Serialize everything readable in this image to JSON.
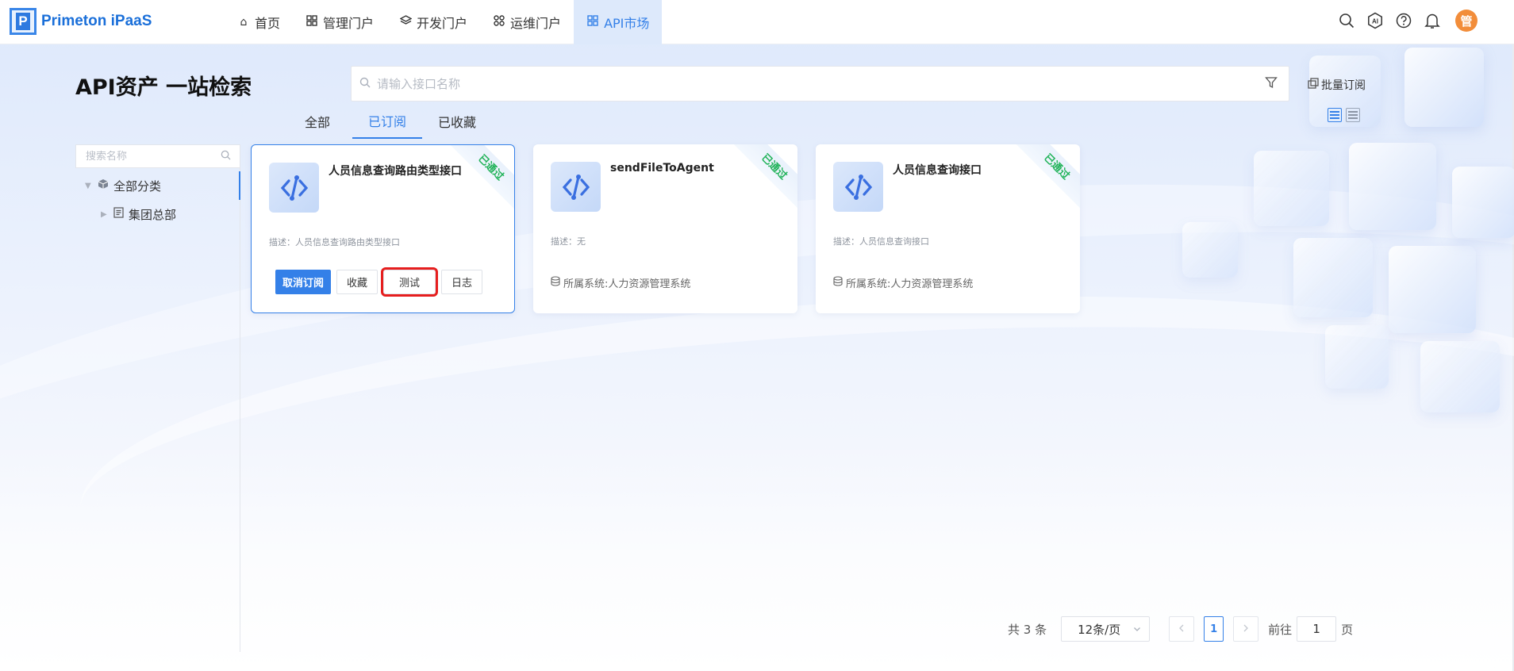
{
  "app": {
    "logo_letter": "P",
    "name": "Primeton iPaaS"
  },
  "nav": [
    {
      "label": "首页",
      "icon": "home-icon"
    },
    {
      "label": "管理门户",
      "icon": "grid-icon"
    },
    {
      "label": "开发门户",
      "icon": "layers-icon"
    },
    {
      "label": "运维门户",
      "icon": "apps-icon"
    },
    {
      "label": "API市场",
      "icon": "grid-icon",
      "active": true
    }
  ],
  "header_tools": {
    "avatar": "管",
    "ai_label": "AI"
  },
  "page": {
    "title": "API资产 一站检索"
  },
  "search": {
    "placeholder": "请输入接口名称",
    "batch_label": "批量订阅"
  },
  "tabs": [
    {
      "label": "全部"
    },
    {
      "label": "已订阅",
      "active": true
    },
    {
      "label": "已收藏"
    }
  ],
  "sidebar": {
    "search_placeholder": "搜索名称",
    "root": "全部分类",
    "child": "集团总部"
  },
  "cards": [
    {
      "title": "人员信息查询路由类型接口",
      "status": "已通过",
      "desc": "描述：人员信息查询路由类型接口",
      "actions": {
        "unsubscribe": "取消订阅",
        "favorite": "收藏",
        "test": "测试",
        "log": "日志"
      }
    },
    {
      "title": "sendFileToAgent",
      "status": "已通过",
      "desc": "描述：无",
      "system": "所属系统:人力资源管理系统"
    },
    {
      "title": "人员信息查询接口",
      "status": "已通过",
      "desc": "描述：人员信息查询接口",
      "system": "所属系统:人力资源管理系统"
    }
  ],
  "pagination": {
    "total": "共 3 条",
    "page_size": "12条/页",
    "current": "1",
    "goto_label": "前往",
    "goto_value": "1",
    "page_unit": "页"
  },
  "colors": {
    "accent": "#3480e8",
    "status_green": "#22b35a",
    "avatar": "#f28d3a",
    "highlight": "#e61e1e"
  }
}
